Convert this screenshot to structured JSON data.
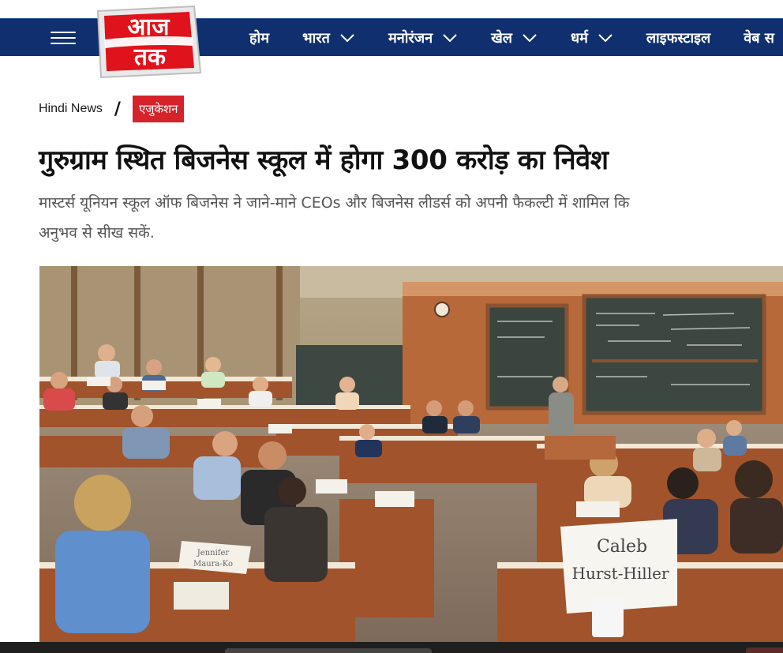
{
  "logo": {
    "text": "आज तक"
  },
  "nav": {
    "items": [
      {
        "label": "होम",
        "has_dropdown": false
      },
      {
        "label": "भारत",
        "has_dropdown": true
      },
      {
        "label": "मनोरंजन",
        "has_dropdown": true
      },
      {
        "label": "खेल",
        "has_dropdown": true
      },
      {
        "label": "धर्म",
        "has_dropdown": true
      },
      {
        "label": "लाइफस्टाइल",
        "has_dropdown": false
      },
      {
        "label": "वेब स",
        "has_dropdown": false
      }
    ]
  },
  "breadcrumb": {
    "home": "Hindi News",
    "separator": "/",
    "category": "एजुकेशन"
  },
  "article": {
    "headline": "गुरुग्राम स्थित बिजनेस स्कूल में होगा 300 करोड़ का निवेश",
    "summary_line1": "मास्टर्स यूनियन स्कूल ऑफ बिजनेस ने जाने-माने CEOs और बिजनेस लीडर्स को अपनी फैकल्टी में शामिल कि",
    "summary_line2": "अनुभव से सीख सकें."
  },
  "hero_image": {
    "name_card_line1": "Caleb",
    "name_card_line2": "Hurst-Hiller",
    "small_card_1": "Jennifer",
    "small_card_2": "Maura-Ko"
  },
  "colors": {
    "nav_bg": "#0f2f6e",
    "brand_red": "#d6222a"
  }
}
